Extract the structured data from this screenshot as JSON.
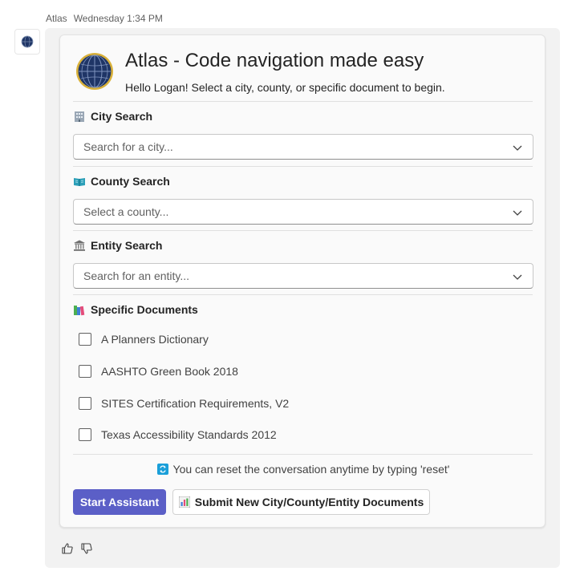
{
  "message": {
    "sender": "Atlas",
    "timestamp": "Wednesday 1:34 PM"
  },
  "card": {
    "title": "Atlas - Code navigation made easy",
    "subtitle": "Hello Logan! Select a city, county, or specific document to begin.",
    "sections": {
      "city": {
        "icon": "office-building-icon",
        "label": "City Search",
        "placeholder": "Search for a city..."
      },
      "county": {
        "icon": "map-book-icon",
        "label": "County Search",
        "placeholder": "Select a county..."
      },
      "entity": {
        "icon": "classical-building-icon",
        "label": "Entity Search",
        "placeholder": "Search for an entity..."
      },
      "documents": {
        "icon": "books-icon",
        "label": "Specific Documents",
        "items": [
          {
            "label": "A Planners Dictionary",
            "checked": false
          },
          {
            "label": "AASHTO Green Book 2018",
            "checked": false
          },
          {
            "label": "SITES Certification Requirements, V2",
            "checked": false
          },
          {
            "label": "Texas Accessibility Standards 2012",
            "checked": false
          }
        ]
      }
    },
    "reset_note": "You can reset the conversation anytime by typing 'reset'",
    "buttons": {
      "start": "Start Assistant",
      "submit": "Submit New City/County/Entity Documents"
    }
  },
  "colors": {
    "accent": "#5b5fc7",
    "globe": "#1f3566",
    "globe_ring": "#d9b13a"
  }
}
